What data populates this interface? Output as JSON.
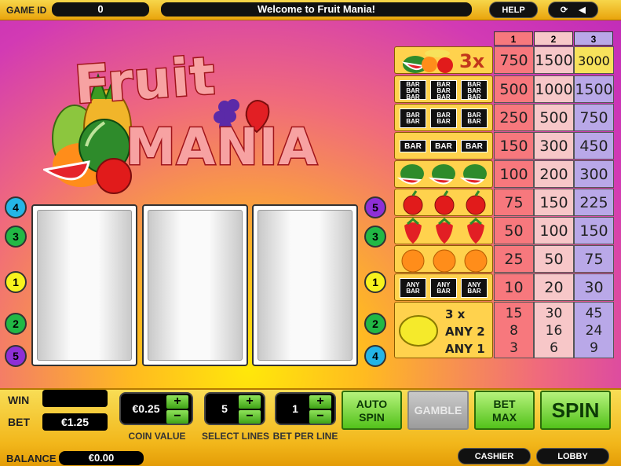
{
  "topbar": {
    "game_id_label": "GAME ID",
    "game_id_value": "0",
    "message": "Welcome to Fruit Mania!",
    "help_label": "HELP"
  },
  "logo": {
    "line1": "Fruit",
    "line2": "MANIA"
  },
  "paytable": {
    "headers": [
      "1",
      "2",
      "3"
    ],
    "rows": [
      {
        "symbol": "mixed-fruit-3x",
        "label": "3x",
        "values": [
          "750",
          "1500",
          "3000"
        ]
      },
      {
        "symbol": "triple-bar",
        "values": [
          "500",
          "1000",
          "1500"
        ]
      },
      {
        "symbol": "double-bar",
        "values": [
          "250",
          "500",
          "750"
        ]
      },
      {
        "symbol": "single-bar",
        "values": [
          "150",
          "300",
          "450"
        ]
      },
      {
        "symbol": "watermelon",
        "values": [
          "100",
          "200",
          "300"
        ]
      },
      {
        "symbol": "cherry",
        "values": [
          "75",
          "150",
          "225"
        ]
      },
      {
        "symbol": "strawberry",
        "values": [
          "50",
          "100",
          "150"
        ]
      },
      {
        "symbol": "orange",
        "values": [
          "25",
          "50",
          "75"
        ]
      },
      {
        "symbol": "any-bar",
        "values": [
          "10",
          "20",
          "30"
        ]
      }
    ],
    "lemon": {
      "lines": [
        "3 x",
        "ANY 2",
        "ANY 1"
      ],
      "col1": [
        "15",
        "8",
        "3"
      ],
      "col2": [
        "30",
        "16",
        "6"
      ],
      "col3": [
        "45",
        "24",
        "9"
      ]
    },
    "bar_text": "BAR",
    "any_text": "ANY"
  },
  "line_markers": {
    "left": [
      "4",
      "3",
      "1",
      "2",
      "5"
    ],
    "right": [
      "5",
      "3",
      "1",
      "2",
      "4"
    ]
  },
  "bottom": {
    "win_label": "WIN",
    "win_value": "",
    "bet_label": "BET",
    "bet_value": "€1.25",
    "coin_value": "€0.25",
    "coin_caption": "COIN VALUE",
    "lines_value": "5",
    "lines_caption": "SELECT LINES",
    "bpl_value": "1",
    "bpl_caption": "BET PER LINE",
    "plus": "+",
    "minus": "−",
    "autospin_line1": "AUTO",
    "autospin_line2": "SPIN",
    "gamble_label": "GAMBLE",
    "betmax_line1": "BET",
    "betmax_line2": "MAX",
    "spin_label": "SPIN",
    "balance_label": "BALANCE",
    "balance_value": "€0.00",
    "cashier_label": "CASHIER",
    "lobby_label": "LOBBY"
  },
  "colors": {
    "line1": "#f7f21d",
    "line2": "#21b845",
    "line3": "#21b845",
    "line4": "#24b5e6",
    "line5": "#8e2fd6"
  }
}
